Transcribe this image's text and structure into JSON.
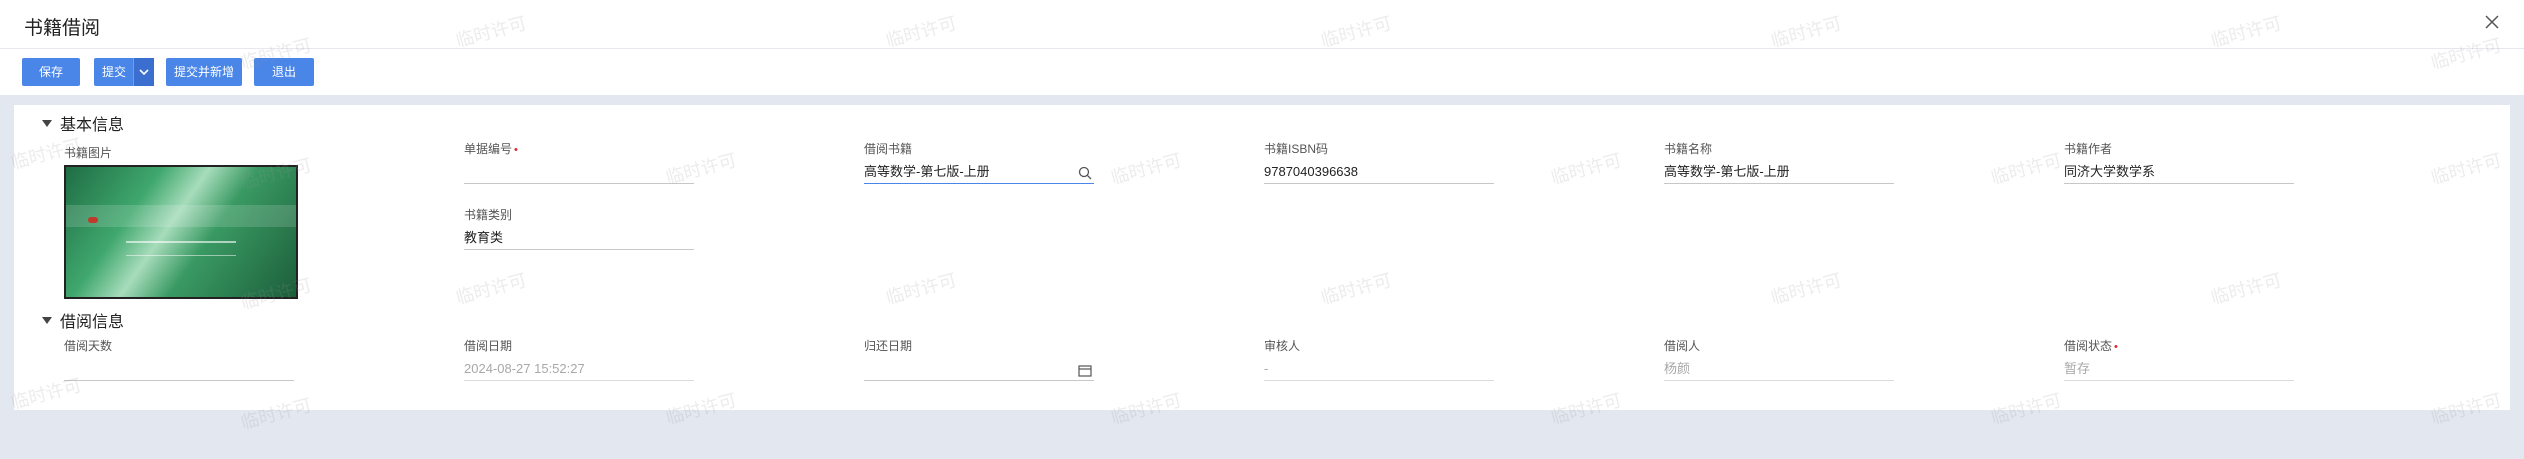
{
  "window": {
    "title": "书籍借阅",
    "close_icon": "close-icon"
  },
  "toolbar": {
    "save_label": "保存",
    "submit_label": "提交",
    "submit_new_label": "提交并新增",
    "exit_label": "退出"
  },
  "sections": {
    "basic": {
      "title": "基本信息"
    },
    "borrow": {
      "title": "借阅信息"
    }
  },
  "basic": {
    "image_label": "书籍图片",
    "doc_no": {
      "label": "单据编号",
      "required": "•",
      "value": ""
    },
    "book": {
      "label": "借阅书籍",
      "value": "高等数学-第七版-上册"
    },
    "isbn": {
      "label": "书籍ISBN码",
      "value": "9787040396638"
    },
    "name": {
      "label": "书籍名称",
      "value": "高等数学-第七版-上册"
    },
    "author": {
      "label": "书籍作者",
      "value": "同济大学数学系"
    },
    "category": {
      "label": "书籍类别",
      "value": "教育类"
    }
  },
  "borrow": {
    "days": {
      "label": "借阅天数",
      "value": ""
    },
    "borrow_date": {
      "label": "借阅日期",
      "value": "2024-08-27 15:52:27"
    },
    "return_date": {
      "label": "归还日期",
      "value": ""
    },
    "reviewer": {
      "label": "审核人",
      "value": "-"
    },
    "borrower": {
      "label": "借阅人",
      "value": "杨颜"
    },
    "status": {
      "label": "借阅状态",
      "required": "•",
      "value": "暂存"
    }
  },
  "watermark_text": "临时许可",
  "colors": {
    "primary": "#4a86e8",
    "required": "#e0282e",
    "page_bg": "#e3e7ef"
  }
}
